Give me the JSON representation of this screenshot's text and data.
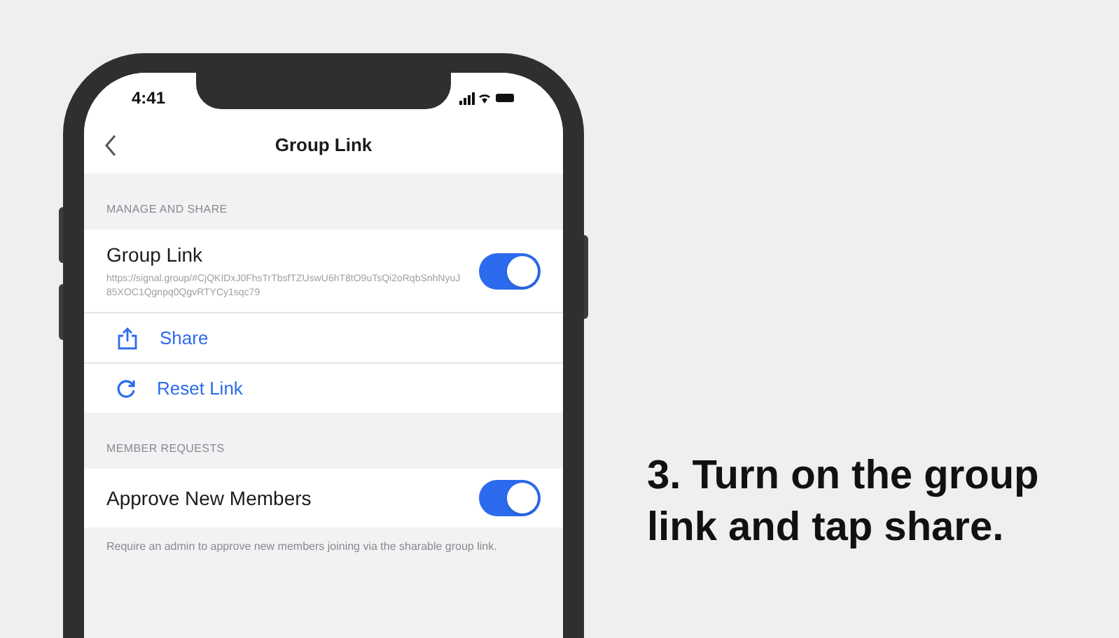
{
  "phone": {
    "status_bar": {
      "time": "4:41"
    },
    "nav": {
      "title": "Group Link"
    },
    "sections": [
      {
        "header": "MANAGE AND SHARE",
        "items": [
          {
            "kind": "toggle",
            "label": "Group Link",
            "detail": "https://signal.group/#CjQKIDxJ0FhsTrTbsfTZUswU6hT8tO9uTsQi2oRqbSnhNyuJ85XOC1Qgnpq0QgvRTYCy1sqc79",
            "on": true
          },
          {
            "kind": "share",
            "label": "Share"
          },
          {
            "kind": "reset",
            "label": "Reset Link"
          }
        ]
      },
      {
        "header": "MEMBER REQUESTS",
        "items": [
          {
            "kind": "toggle",
            "label": "Approve New Members",
            "on": true
          }
        ],
        "footer": "Require an admin to approve new members joining via the sharable group link."
      }
    ]
  },
  "caption": "3. Turn on the group link and tap share."
}
